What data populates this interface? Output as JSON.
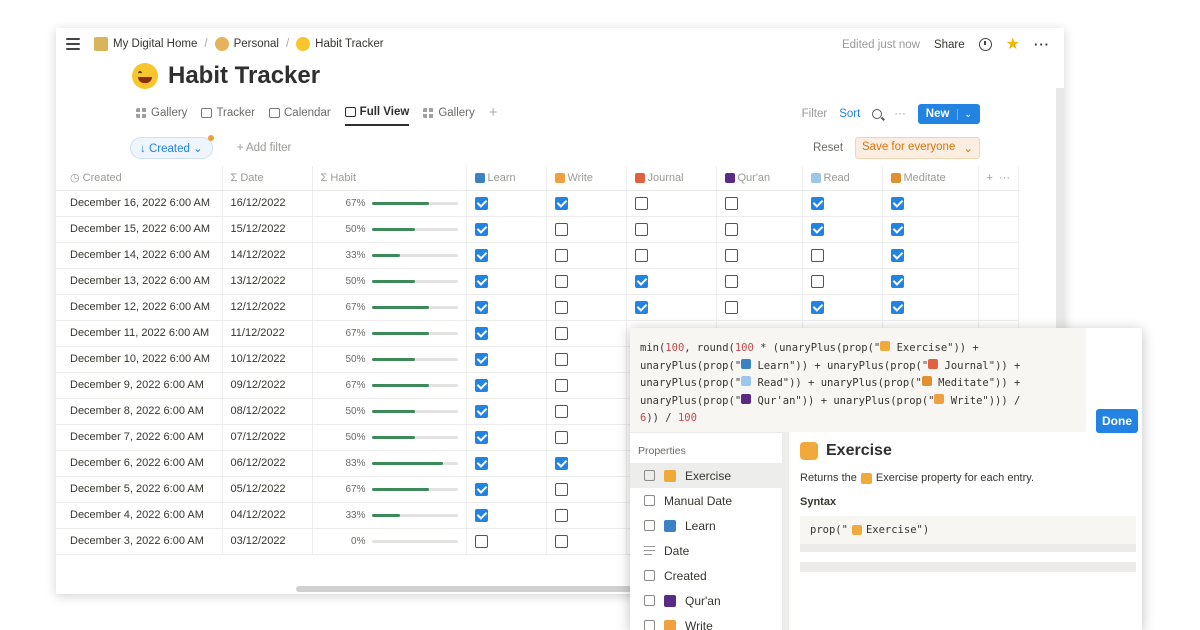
{
  "breadcrumb": {
    "home": "My Digital Home",
    "personal": "Personal",
    "page": "Habit Tracker"
  },
  "topbar": {
    "edited": "Edited just now",
    "share": "Share"
  },
  "page": {
    "title": "Habit Tracker"
  },
  "views": [
    {
      "label": "Gallery",
      "icon": "grid"
    },
    {
      "label": "Tracker",
      "icon": "table"
    },
    {
      "label": "Calendar",
      "icon": "calendar"
    },
    {
      "label": "Full View",
      "icon": "table"
    },
    {
      "label": "Gallery",
      "icon": "grid"
    }
  ],
  "toolbar": {
    "filter": "Filter",
    "sort": "Sort",
    "more": "···",
    "new": "New"
  },
  "filterbar": {
    "created_pill": "↓ Created ⌄",
    "add_filter": "+ Add filter",
    "reset": "Reset",
    "save": "Save for everyone"
  },
  "columns": {
    "created": "Created",
    "date": "Date",
    "habit": "Habit",
    "learn": "Learn",
    "write": "Write",
    "journal": "Journal",
    "quran": "Qur'an",
    "read": "Read",
    "meditate": "Meditate"
  },
  "rows": [
    {
      "created": "December 16, 2022 6:00 AM",
      "date": "16/12/2022",
      "habit": 67,
      "learn": true,
      "write": true,
      "journal": false,
      "quran": false,
      "read": true,
      "meditate": true
    },
    {
      "created": "December 15, 2022 6:00 AM",
      "date": "15/12/2022",
      "habit": 50,
      "learn": true,
      "write": false,
      "journal": false,
      "quran": false,
      "read": true,
      "meditate": true
    },
    {
      "created": "December 14, 2022 6:00 AM",
      "date": "14/12/2022",
      "habit": 33,
      "learn": true,
      "write": false,
      "journal": false,
      "quran": false,
      "read": false,
      "meditate": true
    },
    {
      "created": "December 13, 2022 6:00 AM",
      "date": "13/12/2022",
      "habit": 50,
      "learn": true,
      "write": false,
      "journal": true,
      "quran": false,
      "read": false,
      "meditate": true
    },
    {
      "created": "December 12, 2022 6:00 AM",
      "date": "12/12/2022",
      "habit": 67,
      "learn": true,
      "write": false,
      "journal": true,
      "quran": false,
      "read": true,
      "meditate": true
    },
    {
      "created": "December 11, 2022 6:00 AM",
      "date": "11/12/2022",
      "habit": 67,
      "learn": true,
      "write": false
    },
    {
      "created": "December 10, 2022 6:00 AM",
      "date": "10/12/2022",
      "habit": 50,
      "learn": true,
      "write": false
    },
    {
      "created": "December 9, 2022 6:00 AM",
      "date": "09/12/2022",
      "habit": 67,
      "learn": true,
      "write": false
    },
    {
      "created": "December 8, 2022 6:00 AM",
      "date": "08/12/2022",
      "habit": 50,
      "learn": true,
      "write": false
    },
    {
      "created": "December 7, 2022 6:00 AM",
      "date": "07/12/2022",
      "habit": 50,
      "learn": true,
      "write": false
    },
    {
      "created": "December 6, 2022 6:00 AM",
      "date": "06/12/2022",
      "habit": 83,
      "learn": true,
      "write": true
    },
    {
      "created": "December 5, 2022 6:00 AM",
      "date": "05/12/2022",
      "habit": 67,
      "learn": true,
      "write": false
    },
    {
      "created": "December 4, 2022 6:00 AM",
      "date": "04/12/2022",
      "habit": 33,
      "learn": true,
      "write": false
    },
    {
      "created": "December 3, 2022 6:00 AM",
      "date": "03/12/2022",
      "habit": 0,
      "learn": false,
      "write": false
    }
  ],
  "formula": {
    "done": "Done",
    "properties_title": "Properties",
    "properties": [
      {
        "label": "Exercise",
        "icon": "checkbox-icon",
        "emoji": "#f2a93b",
        "active": true
      },
      {
        "label": "Manual Date",
        "icon": "calendar-icon"
      },
      {
        "label": "Learn",
        "icon": "checkbox-icon",
        "emoji": "#3b82c4"
      },
      {
        "label": "Date",
        "icon": "text-lines-icon"
      },
      {
        "label": "Created",
        "icon": "calendar-icon"
      },
      {
        "label": "Qur'an",
        "icon": "checkbox-icon",
        "emoji": "#5b2a86"
      },
      {
        "label": "Write",
        "icon": "checkbox-icon",
        "emoji": "#f0a040"
      }
    ],
    "detail_title": "Exercise",
    "detail_desc_before": "Returns the",
    "detail_desc_after": "Exercise property for each entry.",
    "syntax_label": "Syntax",
    "syntax_before": "prop(\"",
    "syntax_after": "Exercise\")"
  },
  "colors": {
    "accent": "#2383e2",
    "bar": "#3c8a5a",
    "checked": "#2383e2"
  }
}
